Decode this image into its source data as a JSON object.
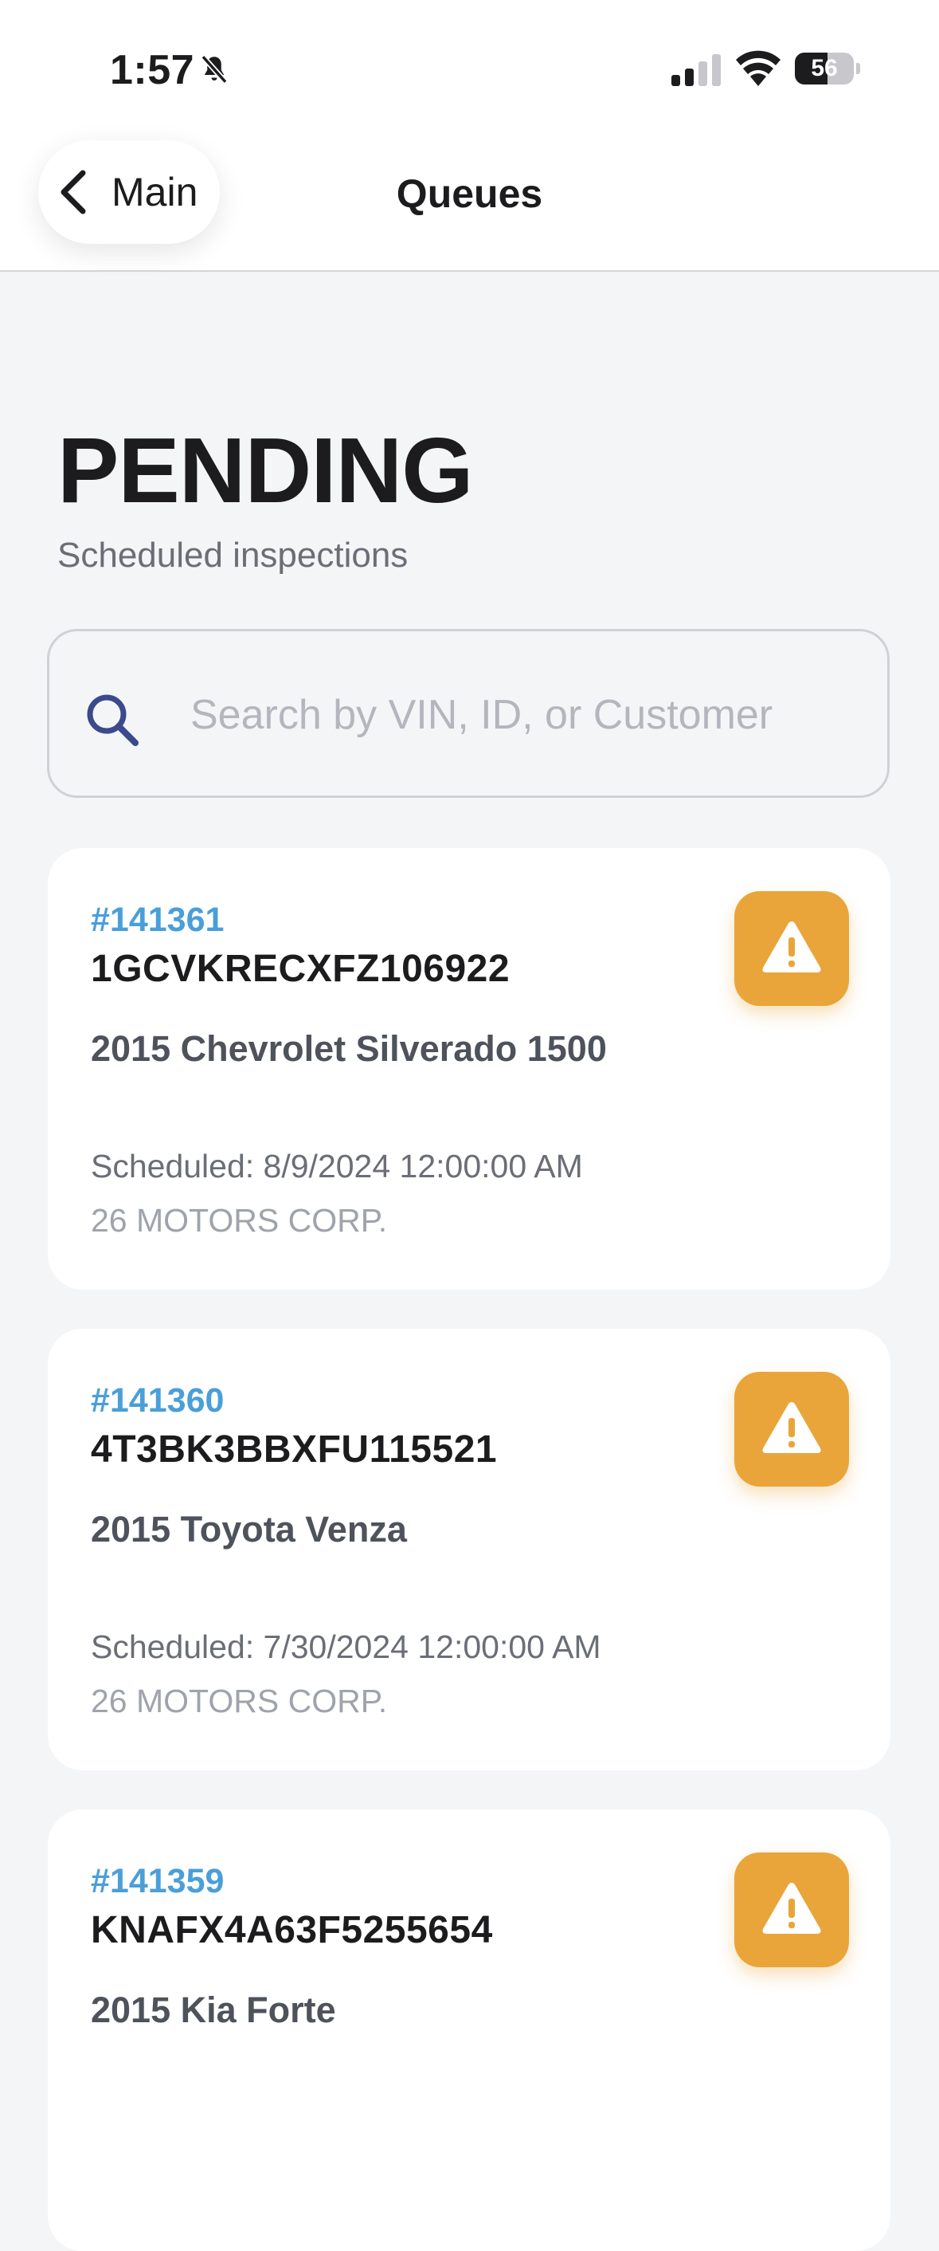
{
  "status_bar": {
    "time": "1:57",
    "battery_level": "56",
    "battery_fraction": 0.56,
    "icons": [
      "bell-slash-icon",
      "cellular-signal-icon",
      "wifi-icon",
      "battery-icon"
    ]
  },
  "nav": {
    "back_label": "Main",
    "title": "Queues"
  },
  "header": {
    "title": "PENDING",
    "subtitle": "Scheduled inspections"
  },
  "search": {
    "placeholder": "Search by VIN, ID, or Customer",
    "value": ""
  },
  "colors": {
    "accent_blue": "#4a9fd8",
    "warning_orange": "#e9a53a",
    "search_icon": "#3a4a8c"
  },
  "cards": [
    {
      "id": "#141361",
      "vin": "1GCVKRECXFZ106922",
      "vehicle": "2015 Chevrolet Silverado 1500",
      "scheduled": "Scheduled: 8/9/2024 12:00:00 AM",
      "company": "26 MOTORS CORP.",
      "status_icon": "warning-icon"
    },
    {
      "id": "#141360",
      "vin": "4T3BK3BBXFU115521",
      "vehicle": "2015 Toyota Venza",
      "scheduled": "Scheduled: 7/30/2024 12:00:00 AM",
      "company": "26 MOTORS CORP.",
      "status_icon": "warning-icon"
    },
    {
      "id": "#141359",
      "vin": "KNAFX4A63F5255654",
      "vehicle": "2015 Kia Forte",
      "scheduled": "",
      "company": "",
      "status_icon": "warning-icon"
    }
  ]
}
